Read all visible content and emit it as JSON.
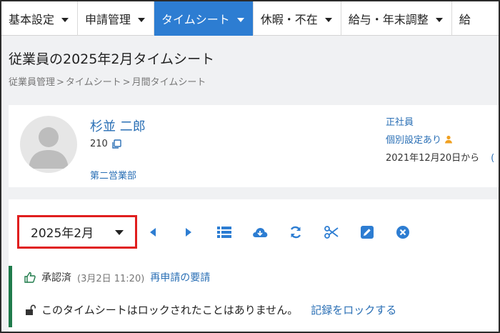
{
  "nav": {
    "items": [
      {
        "label": "基本設定"
      },
      {
        "label": "申請管理"
      },
      {
        "label": "タイムシート"
      },
      {
        "label": "休暇・不在"
      },
      {
        "label": "給与・年末調整"
      },
      {
        "label": "給"
      }
    ]
  },
  "page": {
    "title": "従業員の2025年2月タイムシート",
    "breadcrumb": [
      "従業員管理",
      ">",
      "タイムシート",
      ">",
      "月間タイムシート"
    ]
  },
  "employee": {
    "name": "杉並 二郎",
    "id": "210",
    "department": "第二営業部",
    "type": "正社員",
    "setting": "個別設定あり",
    "since": "2021年12月20日から",
    "paren": "("
  },
  "timesheet": {
    "month": "2025年2月",
    "toolbar_icons": [
      "prev-icon",
      "next-icon",
      "list-icon",
      "cloud-download-icon",
      "refresh-icon",
      "scissors-icon",
      "edit-icon",
      "close-circle-icon"
    ],
    "status": {
      "approved": "承認済",
      "time": "(3月2日 11:20)",
      "reapply_link": "再申請の要請",
      "lock_message": "このタイムシートはロックされたことはありません。",
      "lock_link": "記録をロックする"
    }
  },
  "colors": {
    "accent": "#2d7dd2",
    "link": "#2a6fb5",
    "highlight": "#e01e1e",
    "status_bar": "#1e7a4a"
  }
}
